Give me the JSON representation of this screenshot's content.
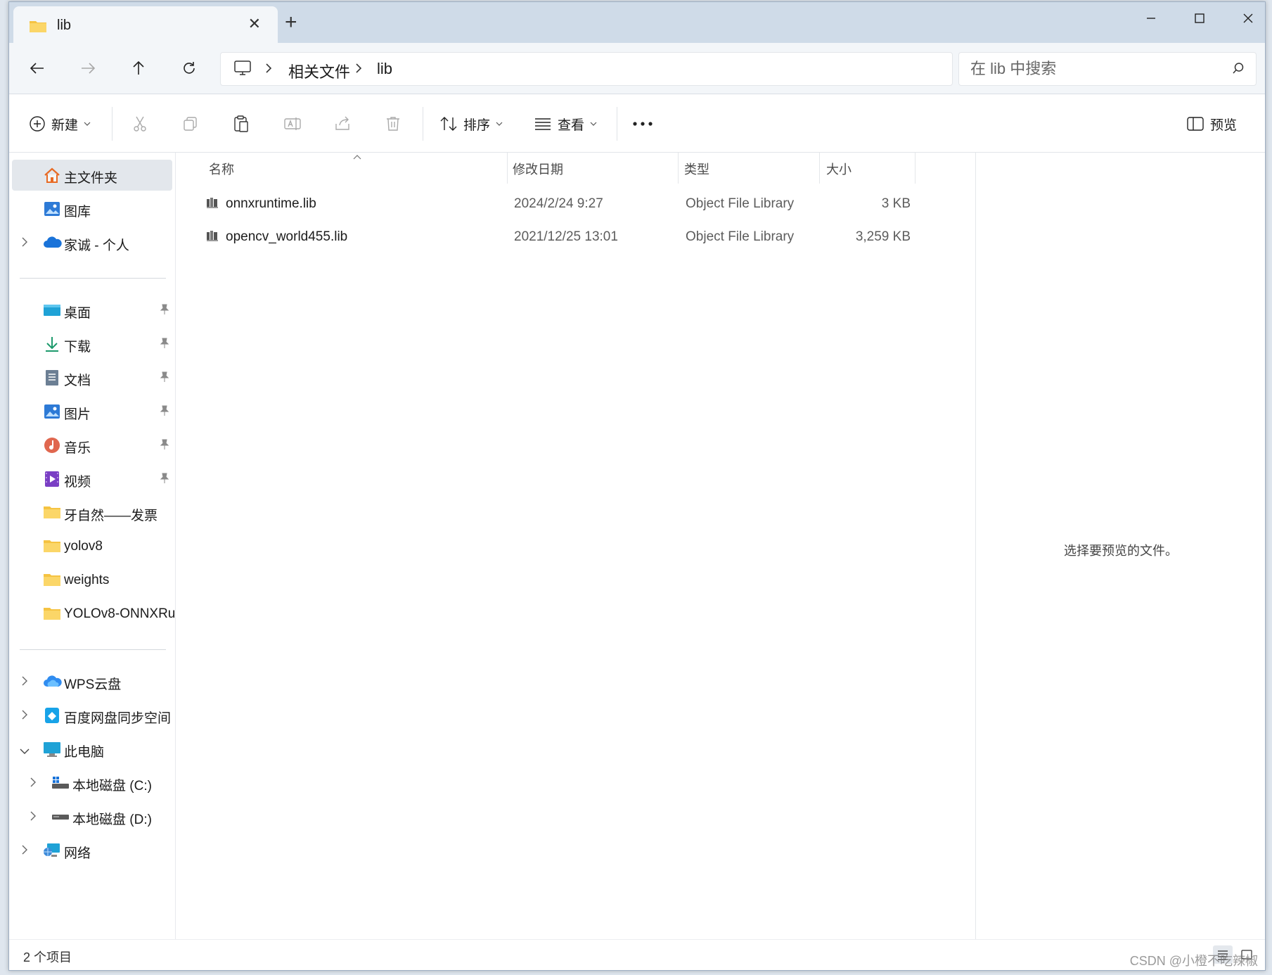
{
  "tab": {
    "title": "lib"
  },
  "address": {
    "crumbs": [
      "相关文件",
      "lib"
    ]
  },
  "search": {
    "placeholder": "在 lib 中搜索"
  },
  "toolbar": {
    "new_label": "新建",
    "sort_label": "排序",
    "view_label": "查看",
    "preview_label": "预览"
  },
  "sidebar": {
    "top": [
      {
        "label": "主文件夹",
        "icon": "home-icon"
      },
      {
        "label": "图库",
        "icon": "gallery-icon"
      },
      {
        "label": "家诚 - 个人",
        "icon": "onedrive-icon"
      }
    ],
    "quick": [
      {
        "label": "桌面",
        "icon": "desktop-icon"
      },
      {
        "label": "下载",
        "icon": "download-icon"
      },
      {
        "label": "文档",
        "icon": "documents-icon"
      },
      {
        "label": "图片",
        "icon": "pictures-icon"
      },
      {
        "label": "音乐",
        "icon": "music-icon"
      },
      {
        "label": "视频",
        "icon": "videos-icon"
      },
      {
        "label": "牙自然——发票",
        "icon": "folder-icon"
      },
      {
        "label": "yolov8",
        "icon": "folder-icon"
      },
      {
        "label": "weights",
        "icon": "folder-icon"
      },
      {
        "label": "YOLOv8-ONNXRu",
        "icon": "folder-icon"
      }
    ],
    "bottom": [
      {
        "label": "WPS云盘",
        "icon": "wps-cloud-icon"
      },
      {
        "label": "百度网盘同步空间",
        "icon": "baidu-netdisk-icon"
      },
      {
        "label": "此电脑",
        "icon": "this-pc-icon"
      },
      {
        "label": "本地磁盘 (C:)",
        "icon": "drive-c-icon"
      },
      {
        "label": "本地磁盘 (D:)",
        "icon": "drive-d-icon"
      },
      {
        "label": "网络",
        "icon": "network-icon"
      }
    ]
  },
  "columns": {
    "name": "名称",
    "date": "修改日期",
    "type": "类型",
    "size": "大小"
  },
  "files": [
    {
      "name": "onnxruntime.lib",
      "date": "2024/2/24 9:27",
      "type": "Object File Library",
      "size": "3 KB"
    },
    {
      "name": "opencv_world455.lib",
      "date": "2021/12/25 13:01",
      "type": "Object File Library",
      "size": "3,259 KB"
    }
  ],
  "preview": {
    "message": "选择要预览的文件。"
  },
  "status": {
    "count": "2 个项目"
  },
  "watermark": "CSDN @小橙不吃辣椒",
  "colors": {
    "titlebar": "#cfdbe8",
    "navrow": "#f3f6f9",
    "selected": "#e3e7ec",
    "folder": "#f5c342"
  }
}
